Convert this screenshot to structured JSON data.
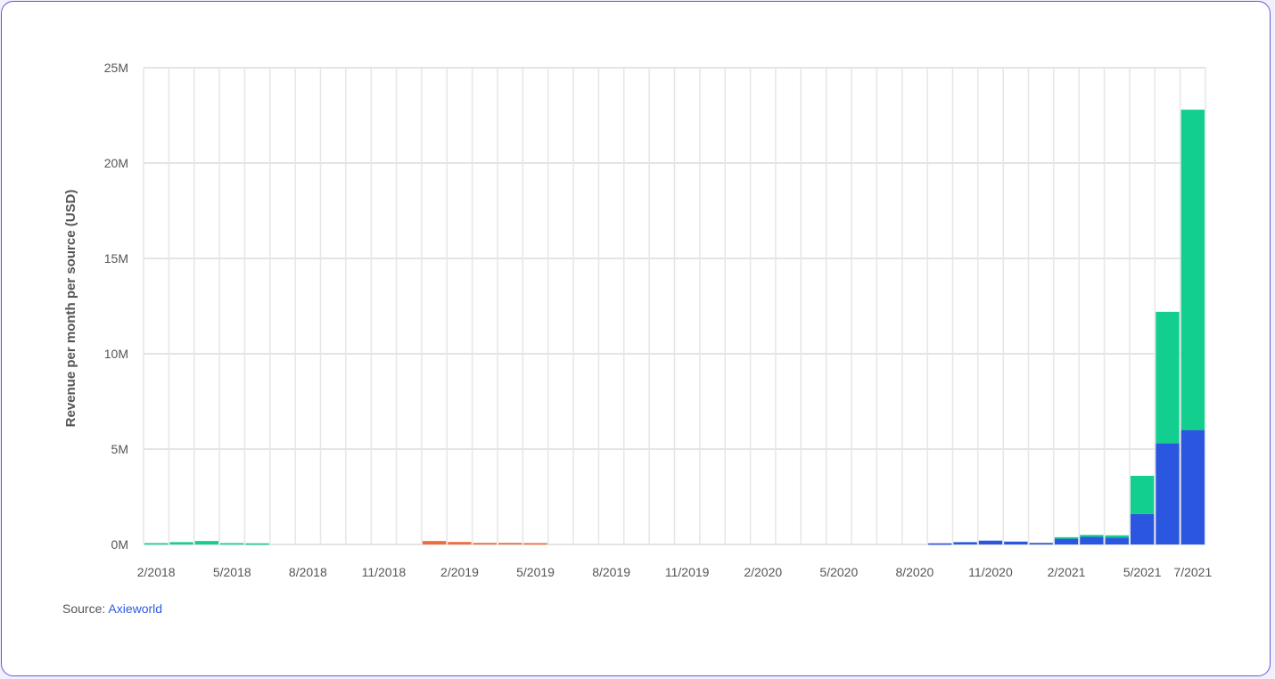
{
  "chart_data": {
    "type": "bar",
    "stacked": true,
    "ylabel": "Revenue per month per source (USD)",
    "ylim": [
      0,
      25000000
    ],
    "yticks": [
      0,
      5000000,
      10000000,
      15000000,
      20000000,
      25000000
    ],
    "ytick_labels": [
      "0M",
      "5M",
      "10M",
      "15M",
      "20M",
      "25M"
    ],
    "grid": true,
    "categories": [
      "2/2018",
      "3/2018",
      "4/2018",
      "5/2018",
      "6/2018",
      "7/2018",
      "8/2018",
      "9/2018",
      "10/2018",
      "11/2018",
      "12/2018",
      "1/2019",
      "2/2019",
      "3/2019",
      "4/2019",
      "5/2019",
      "6/2019",
      "7/2019",
      "8/2019",
      "9/2019",
      "10/2019",
      "11/2019",
      "12/2019",
      "1/2020",
      "2/2020",
      "3/2020",
      "4/2020",
      "5/2020",
      "6/2020",
      "7/2020",
      "8/2020",
      "9/2020",
      "10/2020",
      "11/2020",
      "12/2020",
      "1/2021",
      "2/2021",
      "3/2021",
      "4/2021",
      "5/2021",
      "6/2021",
      "7/2021"
    ],
    "xtick_labels": [
      "2/2018",
      "",
      "",
      "5/2018",
      "",
      "",
      "8/2018",
      "",
      "",
      "11/2018",
      "",
      "",
      "2/2019",
      "",
      "",
      "5/2019",
      "",
      "",
      "8/2019",
      "",
      "",
      "11/2019",
      "",
      "",
      "2/2020",
      "",
      "",
      "5/2020",
      "",
      "",
      "8/2020",
      "",
      "",
      "11/2020",
      "",
      "",
      "2/2021",
      "",
      "",
      "5/2021",
      "",
      "7/2021"
    ],
    "series": [
      {
        "color": "#2b57e0",
        "values": [
          0,
          0,
          0,
          0,
          0,
          0,
          0,
          0,
          0,
          0,
          0,
          0,
          0,
          0,
          0,
          0,
          0,
          0,
          0,
          0,
          0,
          0,
          0,
          0,
          0,
          0,
          0,
          0,
          0,
          0,
          0,
          60000,
          120000,
          200000,
          150000,
          80000,
          300000,
          400000,
          350000,
          1600000,
          5300000,
          6000000
        ]
      },
      {
        "color": "#f26b3a",
        "values": [
          0,
          0,
          0,
          0,
          0,
          0,
          0,
          0,
          0,
          0,
          0,
          180000,
          130000,
          80000,
          80000,
          70000,
          0,
          0,
          0,
          0,
          0,
          0,
          0,
          0,
          0,
          0,
          0,
          0,
          0,
          0,
          0,
          0,
          0,
          0,
          0,
          0,
          0,
          0,
          0,
          0,
          0,
          0
        ]
      },
      {
        "color": "#12cf8f",
        "values": [
          70000,
          120000,
          180000,
          70000,
          60000,
          0,
          0,
          0,
          0,
          0,
          0,
          0,
          0,
          0,
          0,
          0,
          0,
          0,
          0,
          0,
          0,
          0,
          0,
          0,
          0,
          0,
          0,
          0,
          0,
          0,
          0,
          0,
          0,
          0,
          0,
          0,
          80000,
          100000,
          130000,
          2000000,
          6900000,
          16800000
        ]
      }
    ]
  },
  "source": {
    "prefix": "Source: ",
    "link": "Axieworld"
  }
}
